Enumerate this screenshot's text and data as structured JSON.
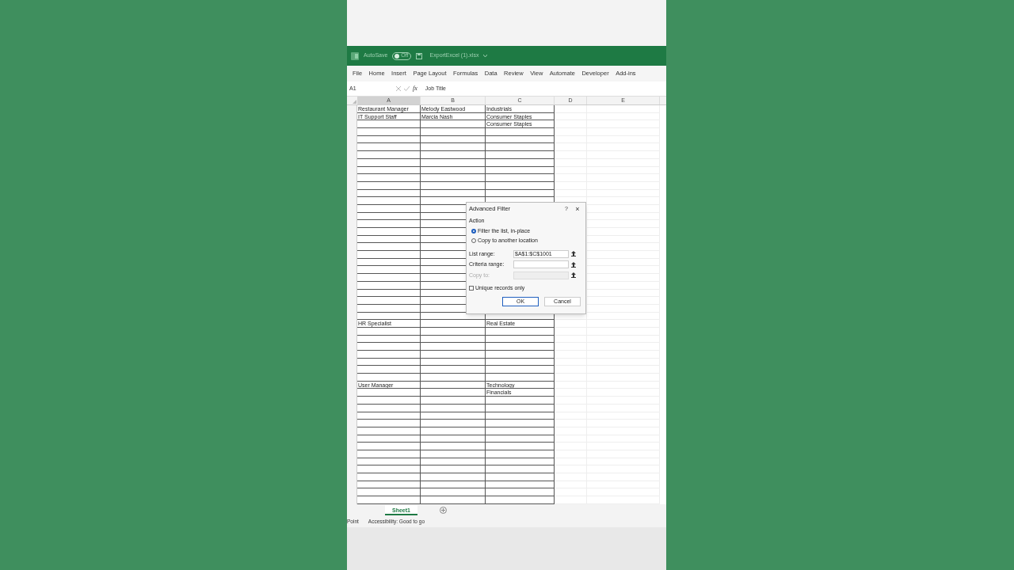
{
  "title_bar": {
    "autosave_label": "AutoSave",
    "autosave": {
      "on": false,
      "label": "Off"
    },
    "file_name": "ExportExcel (1).xlsx"
  },
  "ribbon_tabs": [
    "File",
    "Home",
    "Insert",
    "Page Layout",
    "Formulas",
    "Data",
    "Review",
    "View",
    "Automate",
    "Developer",
    "Add-ins"
  ],
  "formula_bar": {
    "name_box": "A1",
    "fx": "fx",
    "value": "Job Title"
  },
  "columns": [
    {
      "label": "A",
      "selected": true
    },
    {
      "label": "B",
      "selected": false
    },
    {
      "label": "C",
      "selected": false
    },
    {
      "label": "D",
      "selected": false
    },
    {
      "label": "E",
      "selected": false
    }
  ],
  "rows": [
    {
      "a": "Restaurant Manager",
      "b": "Melody Eastwood",
      "c": "Industrials"
    },
    {
      "a": "IT Support Staff",
      "b": "Marcia Nash",
      "c": "Consumer Staples"
    },
    {
      "c": "Consumer Staples"
    },
    {},
    {},
    {},
    {},
    {},
    {},
    {},
    {},
    {},
    {},
    {},
    {},
    {},
    {},
    {},
    {},
    {},
    {},
    {},
    {},
    {},
    {},
    {},
    {},
    {},
    {
      "a": "HR Specialist",
      "c": "Real Estate"
    },
    {},
    {},
    {},
    {},
    {},
    {},
    {},
    {
      "a": "User Manager",
      "c": "Technology"
    },
    {
      "c": "Financials"
    },
    {},
    {},
    {},
    {},
    {},
    {},
    {},
    {},
    {},
    {},
    {},
    {},
    {},
    {}
  ],
  "dialog": {
    "title": "Advanced Filter",
    "help": "?",
    "close": "×",
    "section": "Action",
    "options": [
      {
        "label": "Filter the list, in-place",
        "selected": true
      },
      {
        "label": "Copy to another location",
        "selected": false
      }
    ],
    "fields": [
      {
        "label": "List range:",
        "value": "$A$1:$C$1001",
        "disabled": false
      },
      {
        "label": "Criteria range:",
        "disabled": false
      },
      {
        "label": "Copy to:",
        "disabled": true
      }
    ],
    "checkbox": {
      "label": "Unique records only",
      "checked": false
    },
    "buttons": [
      {
        "label": "OK",
        "kind": "primary"
      },
      {
        "label": "Cancel",
        "kind": "secondary"
      }
    ]
  },
  "sheet_tabs": [
    {
      "label": "Sheet1",
      "selected": true
    }
  ],
  "status_bar": {
    "mode": "Point",
    "accessibility": "Accessibility: Good to go"
  }
}
